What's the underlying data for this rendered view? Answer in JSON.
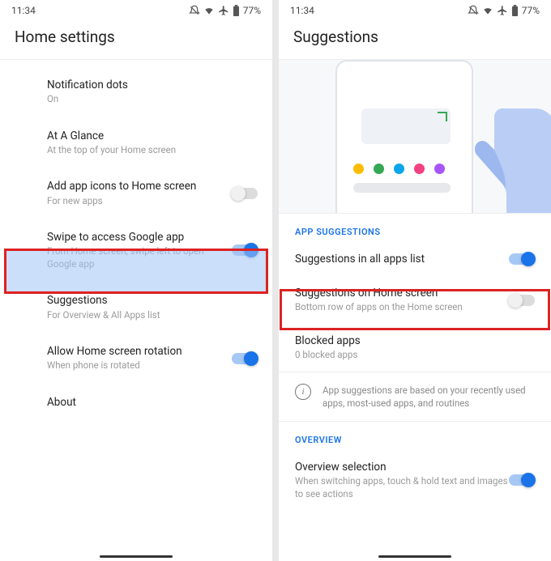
{
  "status": {
    "time": "11:34",
    "battery": "77%"
  },
  "left": {
    "title": "Home settings",
    "rows": [
      {
        "title": "Notification dots",
        "sub": "On"
      },
      {
        "title": "At A Glance",
        "sub": "At the top of your Home screen"
      },
      {
        "title": "Add app icons to Home screen",
        "sub": "For new apps"
      },
      {
        "title": "Swipe to access Google app",
        "sub": "From Home screen, swipe left to open Google app"
      },
      {
        "title": "Suggestions",
        "sub": "For Overview & All Apps list"
      },
      {
        "title": "Allow Home screen rotation",
        "sub": "When phone is rotated"
      },
      {
        "title": "About",
        "sub": ""
      }
    ]
  },
  "right": {
    "title": "Suggestions",
    "section_app": "APP SUGGESTIONS",
    "rows_app": [
      {
        "title": "Suggestions in all apps list",
        "sub": ""
      },
      {
        "title": "Suggestions on Home screen",
        "sub": "Bottom row of apps on the Home screen"
      },
      {
        "title": "Blocked apps",
        "sub": "0 blocked apps"
      }
    ],
    "info": "App suggestions are based on your recently used apps, most-used apps, and routines",
    "section_overview": "OVERVIEW",
    "rows_overview": [
      {
        "title": "Overview selection",
        "sub": "When switching apps, touch & hold text and images to see actions"
      }
    ],
    "hero_dots": [
      "#fbbc04",
      "#34a853",
      "#0ba5ec",
      "#f24182",
      "#a855f7"
    ]
  }
}
